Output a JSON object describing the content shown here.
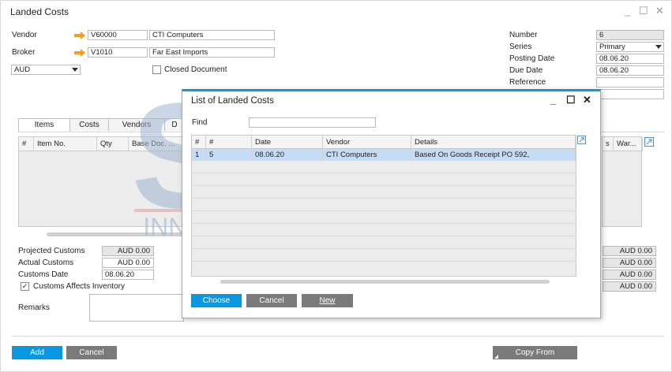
{
  "window": {
    "title": "Landed Costs"
  },
  "header_left": {
    "vendor_label": "Vendor",
    "vendor_code": "V60000",
    "vendor_name": "CTI Computers",
    "broker_label": "Broker",
    "broker_code": "V1010",
    "broker_name": "Far East Imports",
    "currency": "AUD",
    "closed_document_label": "Closed Document"
  },
  "header_right": {
    "number_label": "Number",
    "number_value": "6",
    "series_label": "Series",
    "series_value": "Primary",
    "posting_date_label": "Posting Date",
    "posting_date_value": "08.06.20",
    "due_date_label": "Due Date",
    "due_date_value": "08.06.20",
    "reference_label": "Reference",
    "reference_value": ""
  },
  "tabs": [
    "Items",
    "Costs",
    "Vendors",
    "D"
  ],
  "items_grid": {
    "columns": [
      "#",
      "Item No.",
      "Qty",
      "Base Doc. ..."
    ],
    "right_columns": [
      "s",
      "War..."
    ]
  },
  "totals_left": {
    "projected_customs_label": "Projected Customs",
    "projected_customs_value": "AUD 0.00",
    "actual_customs_label": "Actual Customs",
    "actual_customs_value": "AUD 0.00",
    "customs_date_label": "Customs Date",
    "customs_date_value": "08.06.20",
    "customs_affects_inventory_label": "Customs Affects Inventory",
    "remarks_label": "Remarks"
  },
  "totals_right": [
    "AUD 0.00",
    "AUD 0.00",
    "AUD 0.00",
    "AUD 0.00"
  ],
  "footer": {
    "add_label": "Add",
    "cancel_label": "Cancel",
    "copy_from_label": "Copy From"
  },
  "watermark": {
    "line1": "STEM",
    "line2": "INNOVATION • DESIGN • VALUE",
    "reg": "®"
  },
  "dialog": {
    "title": "List of Landed Costs",
    "find_label": "Find",
    "find_value": "",
    "columns": [
      "#",
      "#",
      "Date",
      "Vendor",
      "Details"
    ],
    "rows": [
      {
        "idx": "1",
        "num": "5",
        "date": "08.06.20",
        "vendor": "CTI Computers",
        "details": "Based On Goods Receipt PO 592,"
      }
    ],
    "choose_label": "Choose",
    "cancel_label": "Cancel",
    "new_label": "New"
  },
  "colors": {
    "accent": "#0a97e1",
    "selected_row": "#c5dcf7",
    "link_arrow": "#f0a020"
  }
}
